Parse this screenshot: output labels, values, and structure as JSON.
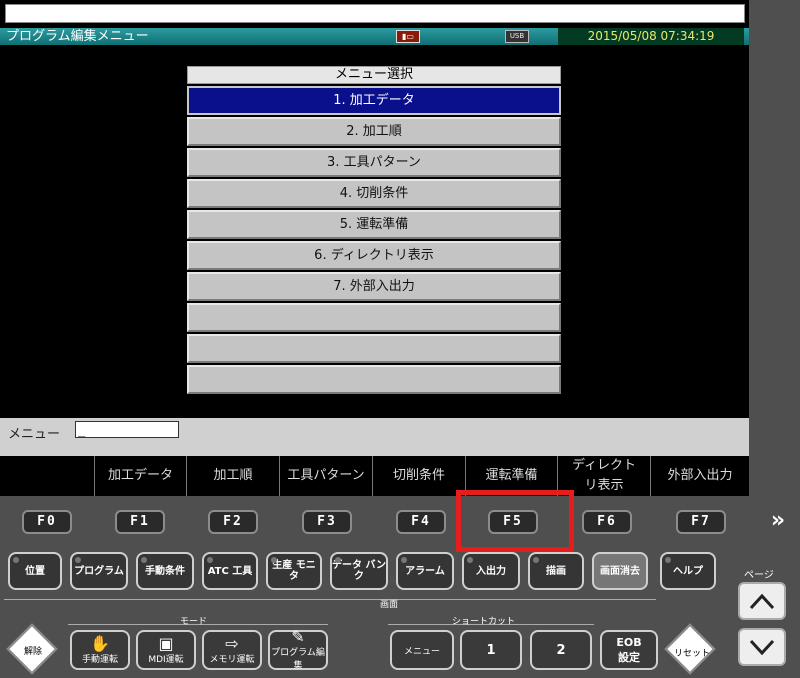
{
  "header": {
    "title": "プログラム編集メニュー",
    "icon_storage": "card-icon",
    "icon_usb": "USB",
    "datetime": "2015/05/08 07:34:19"
  },
  "menu": {
    "title": "メニュー選択",
    "items": [
      {
        "label": "1. 加工データ",
        "selected": true
      },
      {
        "label": "2. 加工順"
      },
      {
        "label": "3. 工具パターン"
      },
      {
        "label": "4. 切削条件"
      },
      {
        "label": "5. 運転準備"
      },
      {
        "label": "6. ディレクトリ表示"
      },
      {
        "label": "7. 外部入出力"
      },
      {
        "label": ""
      },
      {
        "label": ""
      },
      {
        "label": ""
      }
    ]
  },
  "cmdline": {
    "label": "メニュー",
    "value": "_"
  },
  "softkeys": [
    "",
    "加工データ",
    "加工順",
    "工具パターン",
    "切削条件",
    "運転準備",
    "ディレクトリ表示",
    "外部入出力"
  ],
  "fkeys": [
    "F0",
    "F1",
    "F2",
    "F3",
    "F4",
    "F5",
    "F6",
    "F7"
  ],
  "more_symbol": "»",
  "buttons": {
    "position": "位置",
    "program": "プログラム",
    "cutting": "手動条件",
    "atc": "ATC 工具",
    "production": "生産 モニタ",
    "databank": "データ バンク",
    "alarm": "アラーム",
    "io": "入出力",
    "draw": "描画",
    "clear": "画面消去",
    "help": "ヘルプ"
  },
  "labels": {
    "page": "ページ",
    "screen": "画面",
    "mode": "モード",
    "shortcut": "ショートカット"
  },
  "bottom": {
    "release": "解除",
    "manual": "手動運転",
    "mdi": "MDI運転",
    "memory": "メモリ運転",
    "progedit": "プログラム編集",
    "menu": "メニュー",
    "sc1": "1",
    "sc2": "2",
    "eob": "EOB",
    "set": "設定",
    "reset": "リセット"
  }
}
